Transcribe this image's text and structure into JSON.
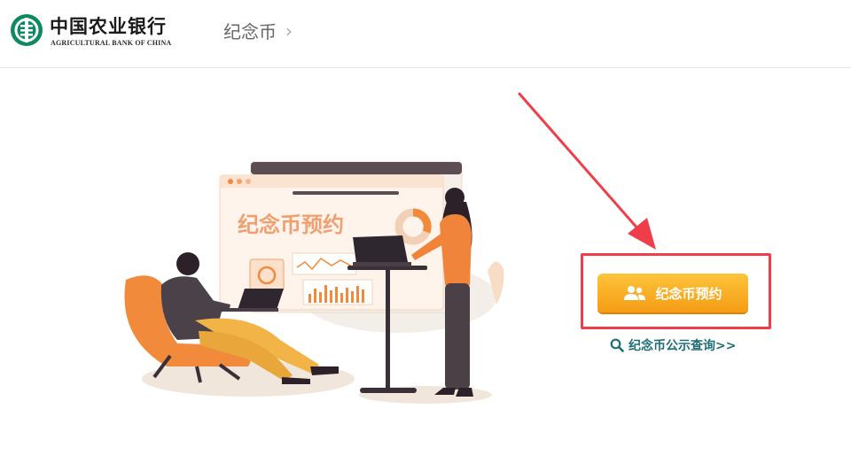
{
  "header": {
    "logo_cn": "中国农业银行",
    "logo_en": "AGRICULTURAL BANK OF CHINA",
    "breadcrumb": "纪念币",
    "breadcrumb_icon": "chevron-right-icon"
  },
  "illustration": {
    "screen_heading": "纪念币预约"
  },
  "actions": {
    "reserve_label": "纪念币预约",
    "reserve_icon": "users-icon",
    "query_label": "纪念币公示查询>>",
    "query_icon": "search-icon"
  },
  "colors": {
    "brand_green": "#0e8a5f",
    "accent_orange": "#f59c15",
    "highlight_red": "#ef3e4a",
    "link_teal": "#1d6f76"
  }
}
